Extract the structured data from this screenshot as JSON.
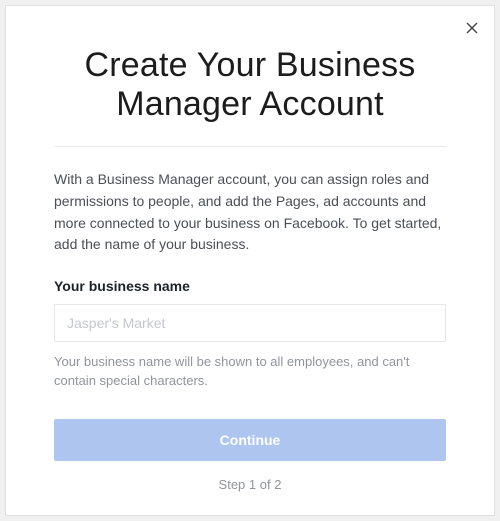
{
  "header": {
    "title": "Create Your Business Manager Account"
  },
  "body": {
    "description": "With a Business Manager account, you can assign roles and permissions to people, and add the Pages, ad accounts and more connected to your business on Facebook. To get started, add the name of your business.",
    "field_label": "Your business name",
    "input_placeholder": "Jasper's Market",
    "helper_text": "Your business name will be shown to all employees, and can't contain special characters."
  },
  "footer": {
    "continue_label": "Continue",
    "step_text": "Step 1 of 2"
  }
}
